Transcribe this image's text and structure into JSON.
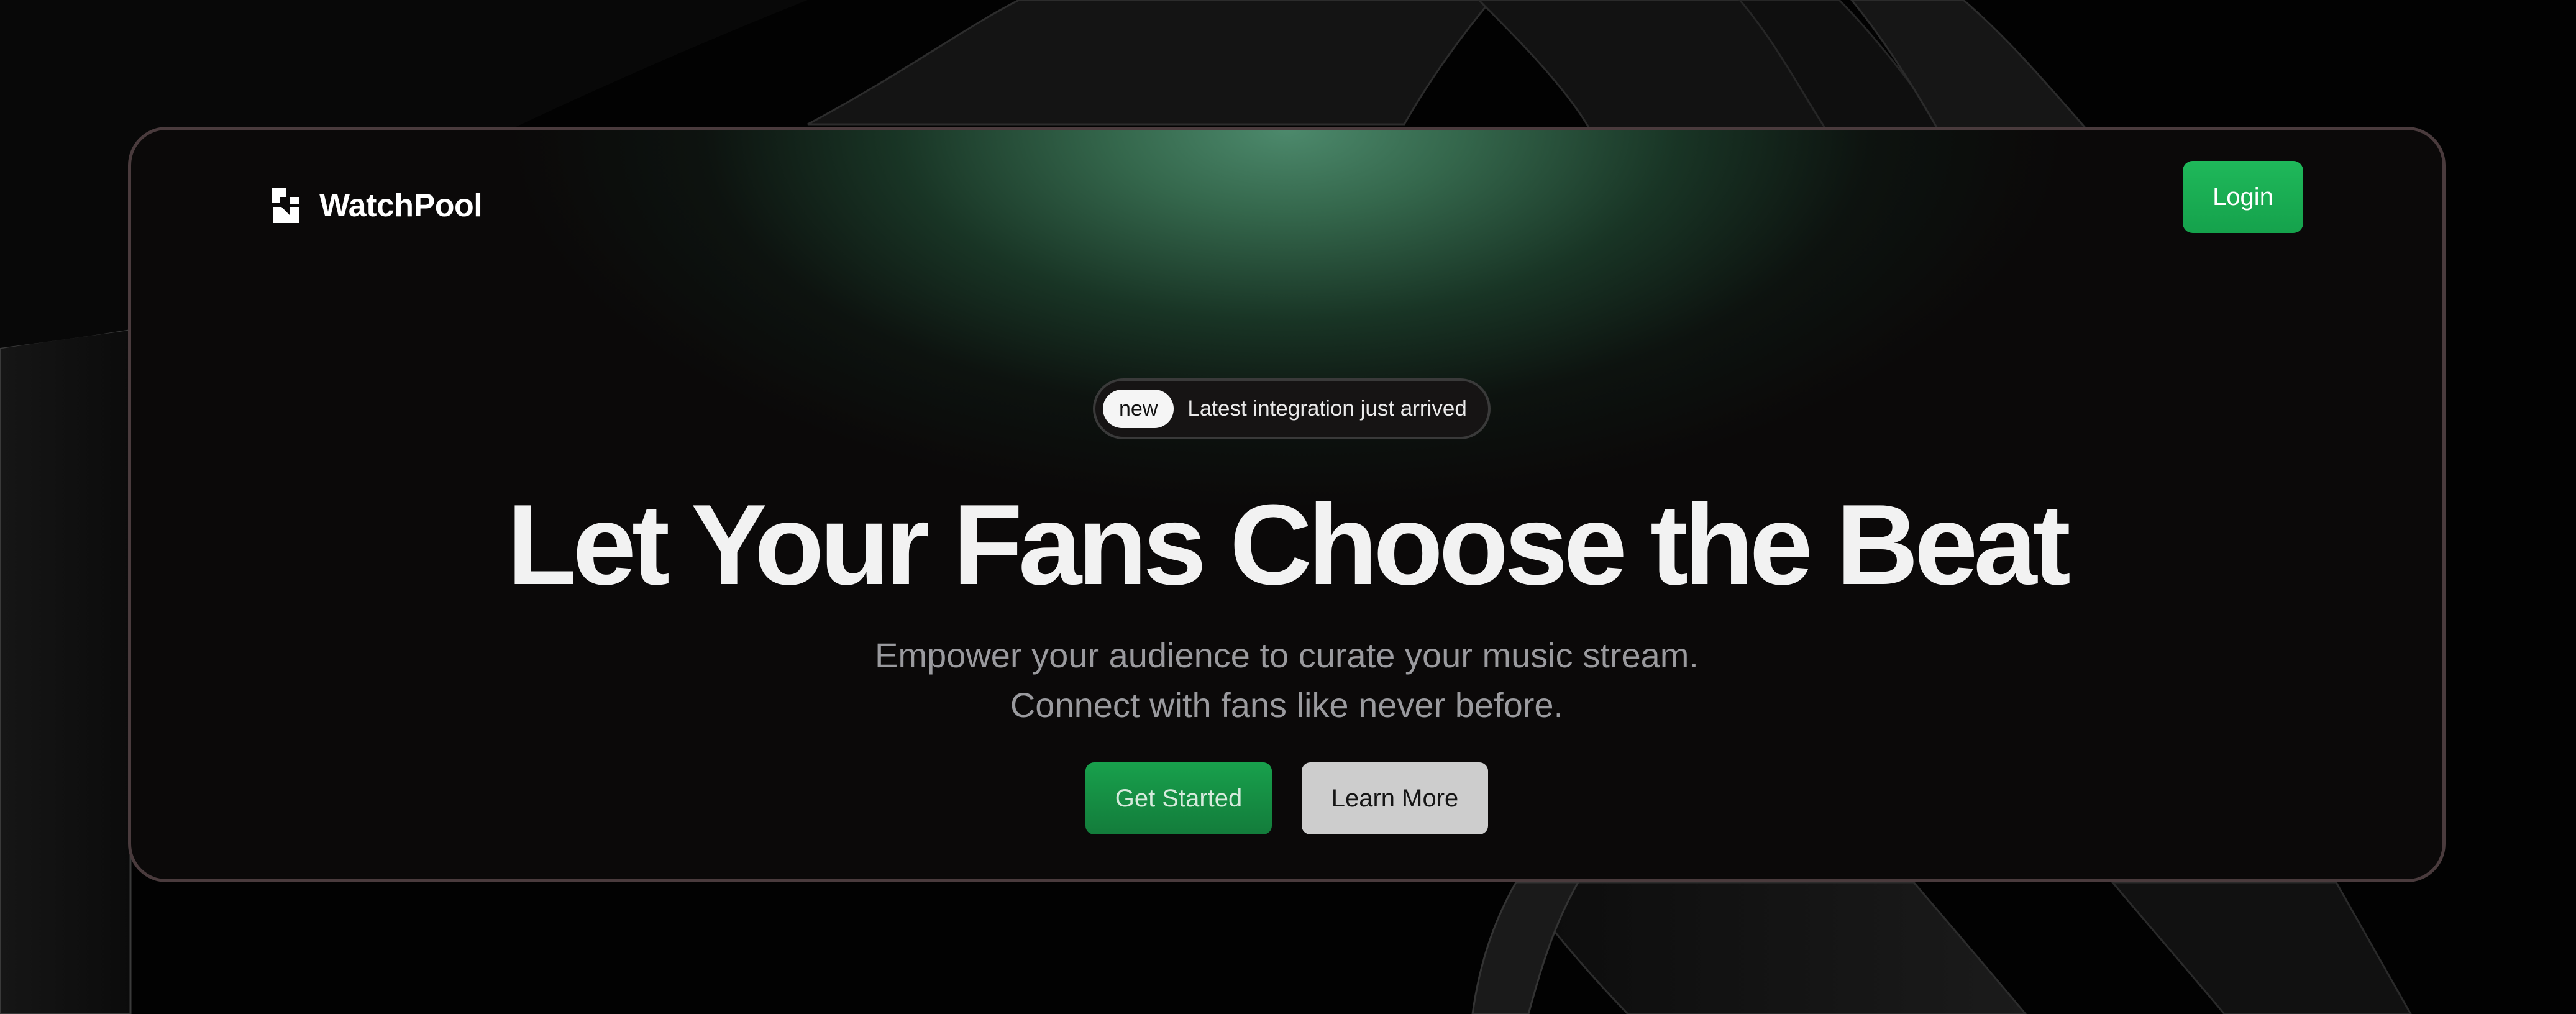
{
  "brand": {
    "name": "WatchPool",
    "icon": "logo-icon"
  },
  "nav": {
    "login_label": "Login"
  },
  "announcement": {
    "tag": "new",
    "text": "Latest integration just arrived"
  },
  "hero": {
    "title": "Let Your Fans Choose the Beat",
    "subtitle_line1": "Empower your audience to curate your music stream.",
    "subtitle_line2": "Connect with fans like never before.",
    "primary_cta": "Get Started",
    "secondary_cta": "Learn More"
  },
  "colors": {
    "accent": "#1fb85a",
    "glow": "#4e8c6e",
    "card_background": "#0b0909",
    "card_border": "#4a3b3d",
    "page_background": "#020202"
  }
}
